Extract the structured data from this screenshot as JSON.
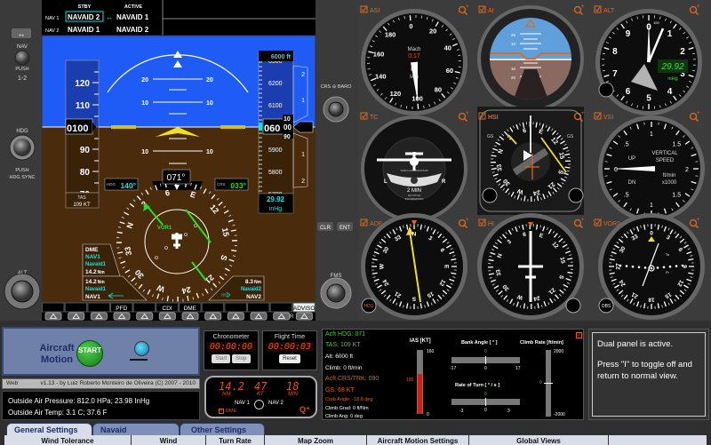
{
  "nav_radio": {
    "stby_label": "STBY",
    "active_label": "ACTIVE",
    "nav1_label": "NAV 1",
    "nav2_label": "NAV 2",
    "nav1_stby": "NAVAID 2",
    "nav1_active": "NAVAID 1",
    "nav2_stby": "NAVAID 1",
    "nav2_active": "NAVAID 2",
    "swap_icon": "↔"
  },
  "left_bezel": {
    "swap_icon": "↔",
    "nav_label": "NAV",
    "push_label": "PUSH",
    "nav_push_value": "1-2",
    "hdg_label": "HDG",
    "hdg_push_label": "PUSH",
    "hdg_sync_label": "HDG SYNC",
    "alt_label": "ALT"
  },
  "middle_bezel": {
    "crs_baro_label": "CRS ⊖ BARO",
    "clr_label": "CLR",
    "ent_label": "ENT",
    "fms_label": "FMS"
  },
  "pfd": {
    "airspeed_ticks": [
      "120",
      "110",
      "90",
      "80",
      "70"
    ],
    "airspeed_readout": "0100",
    "tas_label": "TAS",
    "tas_value": "109 KT",
    "selected_altitude": "6000 ft",
    "altitude_ticks": [
      "6300",
      "6200",
      "6100",
      "5900",
      "5800",
      "5700"
    ],
    "altitude_readout_major": "060",
    "altitude_readout_minor": "00",
    "altitude_roll_up": "10",
    "altitude_roll_down": "90",
    "vsi_ticks": [
      "2",
      "1",
      "1",
      "2"
    ],
    "baro_value": "29.92",
    "baro_unit": "inHg",
    "pitch_labels": [
      "20",
      "10",
      "10"
    ],
    "heading_readout": "071°",
    "heading_bug_label": "HDG",
    "heading_bug_value": "140°",
    "course_label": "CRS",
    "course_value": "033°",
    "heading": 71,
    "compass_labels": [
      "N",
      "3",
      "6",
      "E",
      "12",
      "15",
      "S",
      "21",
      "24",
      "W",
      "30",
      "33"
    ],
    "vor_label": "VOR1",
    "dme_box": {
      "title": "DME",
      "source": "NAV1",
      "navaid": "Navaid1",
      "distance": "14.2",
      "unit": "Nm"
    },
    "bearing1": {
      "distance": "14.2",
      "unit": "Nm",
      "navaid": "Navaid1",
      "source": "NAV1"
    },
    "bearing2": {
      "distance": "8.3",
      "unit": "Nm",
      "navaid": "Navaid2",
      "source": "NAV2"
    },
    "softkeys": [
      "",
      "",
      "",
      "PFD",
      "",
      "CDI",
      "DME",
      "",
      "",
      "",
      "",
      "ADVISO"
    ],
    "softkey_extra": "R"
  },
  "instruments": {
    "asi": {
      "label": "ASI",
      "scale": [
        "0",
        "20",
        "40",
        "60",
        "80",
        "100",
        "120",
        "140",
        "160",
        "180"
      ],
      "mach_label": "Mach",
      "mach_value": "0.17",
      "unit1": "KT",
      "unit2": "IAS",
      "ias": 100
    },
    "ai": {
      "label": "AI",
      "pitch_labels": [
        "20",
        "10",
        "10",
        "20"
      ]
    },
    "alt": {
      "label": "ALT",
      "scale": [
        "0",
        "1",
        "2",
        "3",
        "4",
        "5",
        "6",
        "7",
        "8",
        "9"
      ],
      "baro": "29.92",
      "baro_unit": "inHg",
      "marker": "100"
    },
    "tc": {
      "label": "TC",
      "left": "L",
      "right": "R",
      "two_min": "2 MIN",
      "title": "TURN COORDINATOR",
      "note1": "NO PITCH",
      "note2": "INFORMATION"
    },
    "hsi": {
      "label": "HSI",
      "gs_left": "GS",
      "gs_right": "GS"
    },
    "vsi": {
      "label": "VSI",
      "scale": [
        "0",
        ".5",
        "1",
        "1.5",
        "2",
        "1.5",
        "1",
        ".5"
      ],
      "up": "UP",
      "dn": "DN",
      "title1": "VERTICAL",
      "title2": "SPEED",
      "unit1": "ft/min",
      "unit2": "x1000"
    },
    "adf": {
      "label": "ADF",
      "hdg_button": "HDG"
    },
    "hi": {
      "label": "HI"
    },
    "vor2": {
      "label": "VOR2",
      "scale": [
        "0",
        "3",
        "6",
        "9",
        "12",
        "15",
        "18",
        "21",
        "24",
        "27",
        "30",
        "33"
      ],
      "to_label": "To",
      "fr_label": "Fr",
      "obs_button": "OBS"
    }
  },
  "aircraft_motion": {
    "title": "Aircraft Motion",
    "start_label": "START"
  },
  "version": {
    "left": "Web",
    "text": "v1.13 - by Luiz Roberto Monteiro de Oliveira  (C) 2007 - 2010"
  },
  "outside": {
    "pressure": "Outside Air Pressure: 812.0 HPa;  23.98 InHg",
    "temp": "Outside Air Temp: 3.1 C;  37.6 F"
  },
  "chronometer": {
    "title": "Chronometer",
    "value": "00:00:00",
    "start": "Start",
    "stop": "Stop"
  },
  "flight_time": {
    "title": "Flight Time",
    "value": "00:00:03",
    "reset": "Reset"
  },
  "dme_display": {
    "distance": "14.2",
    "distance_unit": "NM",
    "speed": "47",
    "speed_unit": "KT",
    "time": "18",
    "time_unit": "MIN",
    "nav1": "NAV 1",
    "nav2": "NAV 2",
    "dme_label": "DME"
  },
  "flight_data": {
    "hdg": "Acft HDG: 071",
    "tas": "TAS: 109 KT",
    "alt": "Alt: 6000 ft",
    "climb": "Climb: 0 ft/min",
    "crs": "Acft CRS/TRK: 090",
    "gs": "GS: 68 KT",
    "crab": "Crab Angle: -18.8 deg",
    "climb_grad": "Climb Grad: 0 ft/Nm",
    "climb_ang": "Climb Ang: 0 deg",
    "ias_title": "IAS [KT]",
    "ias_max": "160",
    "ias_value": "100",
    "ias_min": "0",
    "ias_fraction": 0.625,
    "bank_title": "Bank Angle [ ° ]",
    "bank_value": "0",
    "bank_min": "-17",
    "bank_mid": "0",
    "bank_max": "17",
    "turn_title": "Rate of Turn [ ° / s ]",
    "turn_value": "0",
    "turn_min": "-3",
    "turn_mid": "0",
    "turn_max": "3",
    "climb_title": "Climb Rate [ft/min]",
    "climb_max": "2000",
    "climb_value": "0",
    "climb_min": "-2000"
  },
  "message": {
    "line1": "Dual panel is active.",
    "line2": "Press \"I\" to toggle off and return to normal view."
  },
  "tabs": [
    "General Settings",
    "Navaid Information",
    "Other Settings"
  ],
  "settings_columns": [
    "Wind Tolerance",
    "Wind",
    "Turn Rate",
    "Map Zoom",
    "Aircraft Motion Settings",
    "Global Views",
    ""
  ],
  "colors": {
    "sky": "#1f5bf5",
    "ground": "#4a2c0c",
    "cyan": "#19e0e0",
    "green": "#22e022",
    "orange": "#e0601a",
    "yellow": "#f0e020"
  }
}
